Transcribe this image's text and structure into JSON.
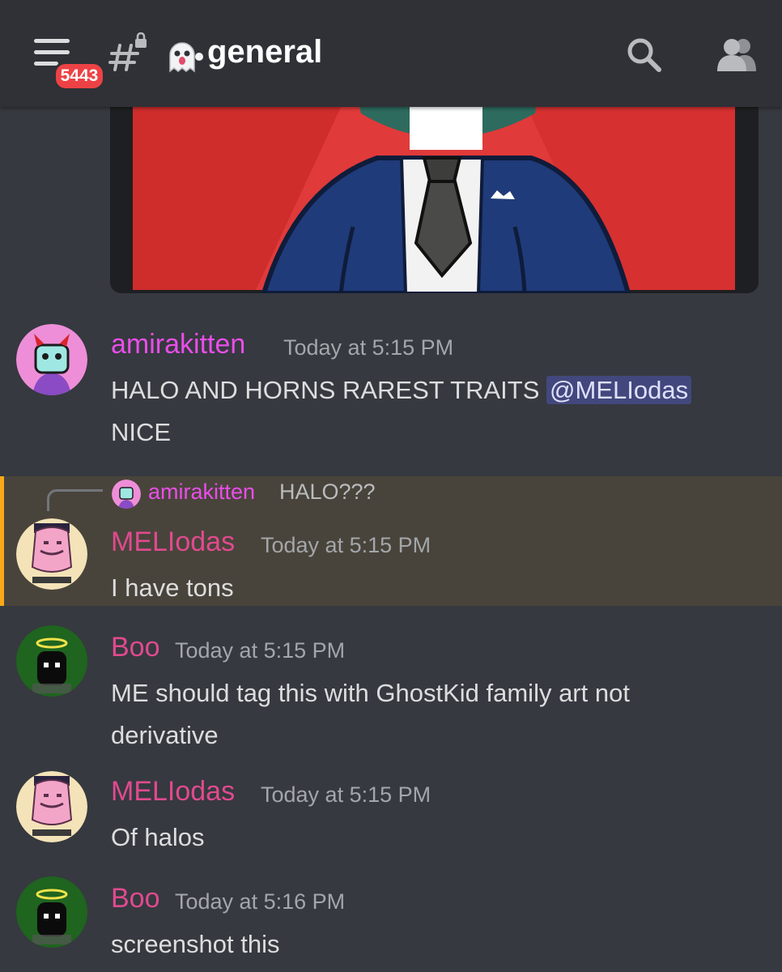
{
  "header": {
    "unread_badge": "5443",
    "channel_name": "general",
    "channel_emoji": "ghost-emoji"
  },
  "icons": {
    "menu": "hamburger-menu-icon",
    "channel": "locked-text-channel-icon",
    "search": "search-icon",
    "members": "members-icon"
  },
  "colors": {
    "background": "#36393f",
    "header": "#2f3136",
    "amirakitten_name": "#e94ee9",
    "mellodas_name": "#e04a8f",
    "boo_name": "#e04a8f",
    "mention_bg": "#4f5382",
    "highlight_bar": "#faa81a"
  },
  "messages": [
    {
      "author": "amirakitten",
      "timestamp": "Today at 5:15 PM",
      "text_before": "HALO AND HORNS RAREST TRAITS ",
      "mention": "@MELIodas",
      "text_after": "NICE"
    },
    {
      "reply_to_author": "amirakitten",
      "reply_to_text": "HALO???",
      "author": "MELIodas",
      "timestamp": "Today at 5:15 PM",
      "text": "I have tons"
    },
    {
      "author": "Boo",
      "timestamp": "Today at 5:15 PM",
      "text": "ME should tag this with GhostKid family art not derivative"
    },
    {
      "author": "MELIodas",
      "timestamp": "Today at 5:15 PM",
      "text": "Of halos"
    },
    {
      "author": "Boo",
      "timestamp": "Today at 5:16 PM",
      "text": "screenshot this"
    }
  ]
}
